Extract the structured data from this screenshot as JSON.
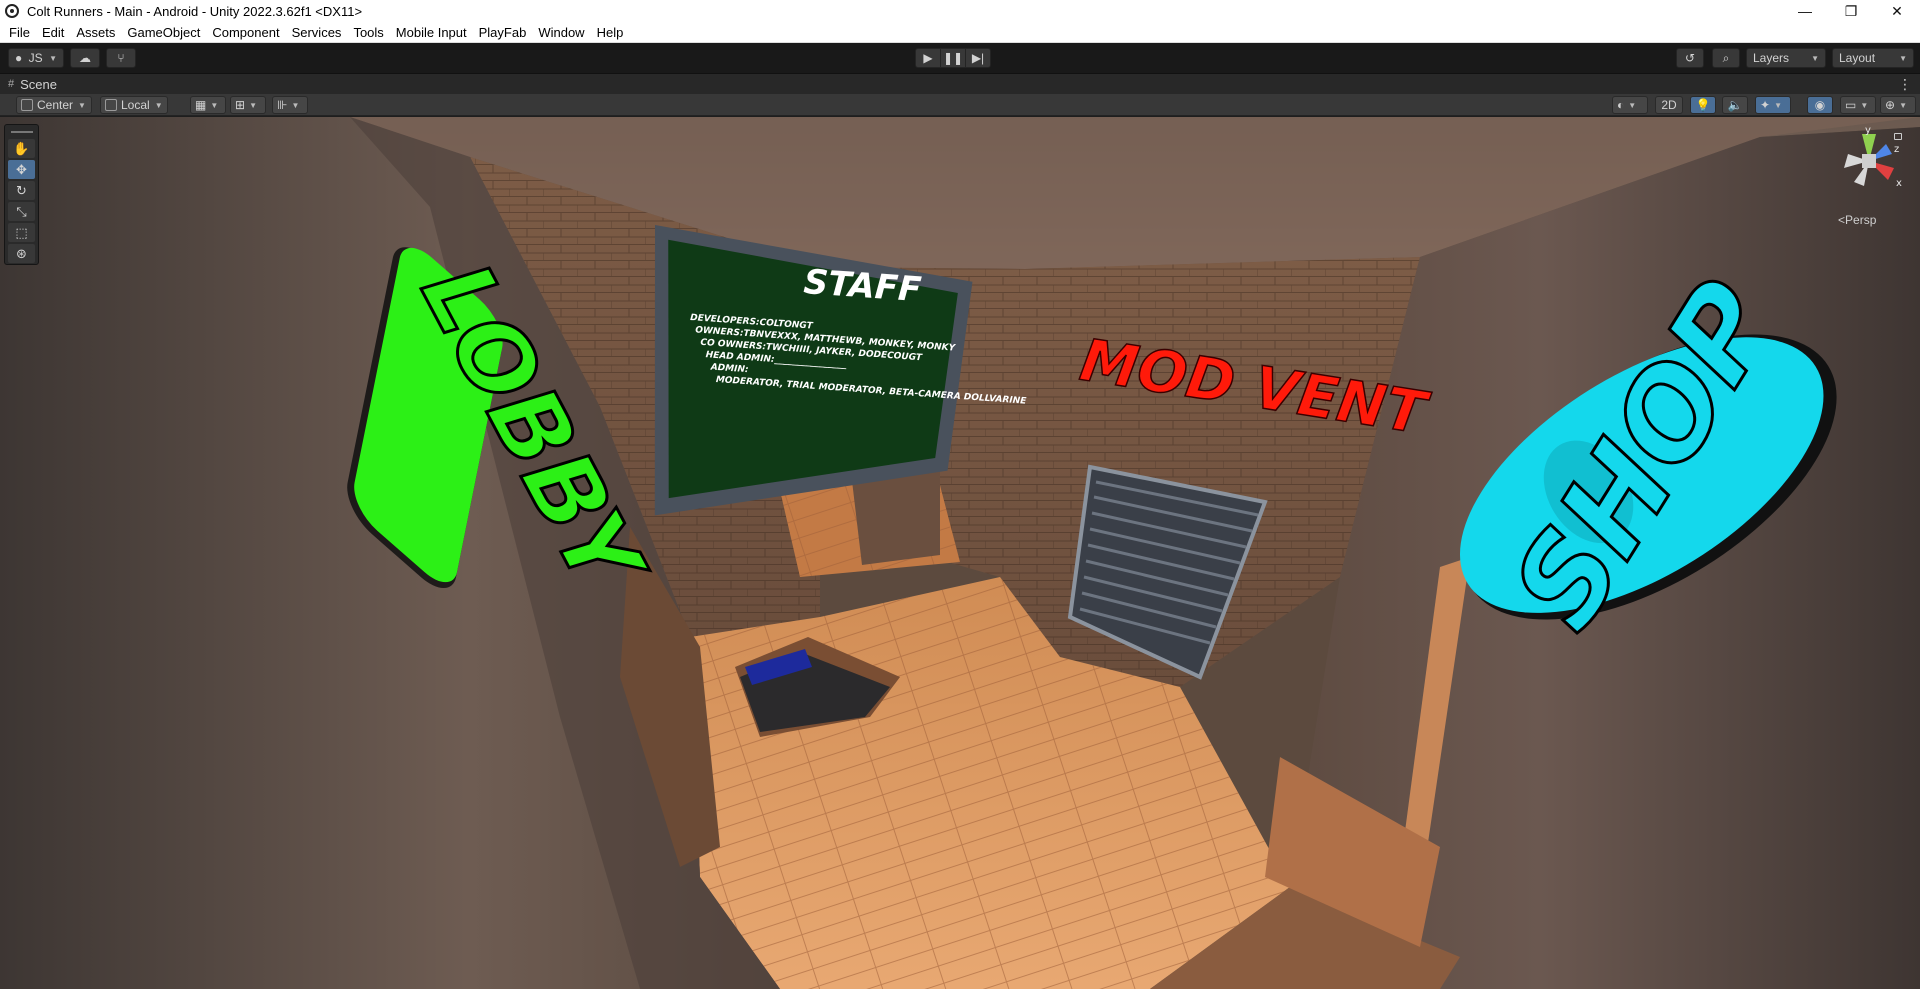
{
  "window": {
    "title": "Colt Runners - Main - Android - Unity 2022.3.62f1 <DX11>",
    "controls": [
      "—",
      "❐",
      "✕"
    ]
  },
  "menu": [
    "File",
    "Edit",
    "Assets",
    "GameObject",
    "Component",
    "Services",
    "Tools",
    "Mobile Input",
    "PlayFab",
    "Window",
    "Help"
  ],
  "toolbar": {
    "account_label": "JS",
    "layers_label": "Layers",
    "layout_label": "Layout"
  },
  "scene_tab": {
    "label": "Scene"
  },
  "scene_toolbar": {
    "pivot_label": "Center",
    "space_label": "Local",
    "mode_2d_label": "2D"
  },
  "gizmo": {
    "persp_label": "Persp",
    "axes": [
      "y",
      "z",
      "x"
    ]
  },
  "scene_signs": {
    "staff_board_title": "STAFF",
    "staff_board_lines": [
      "DEVELOPERS:COLTONGT",
      "OWNERS:TBNVEXXX, MATTHEWB, MONKEY, MONKY",
      "CO OWNERS:TWCHIIII, JAYKER, DODECOUGT",
      "HEAD ADMIN:________________",
      "ADMIN:",
      "MODERATOR, TRIAL MODERATOR, BETA-CAMERA DOLLVARINE"
    ],
    "vent_sign": "MOD VENT",
    "shop_sign": "SHOP",
    "left_sign": "LOBBY"
  },
  "colors": {
    "accent": "#4a6e96",
    "staff_board": "#0f3a16",
    "vent_text": "#ff1a0a",
    "shop_text": "#14d8ec",
    "left_text": "#2cf016"
  }
}
